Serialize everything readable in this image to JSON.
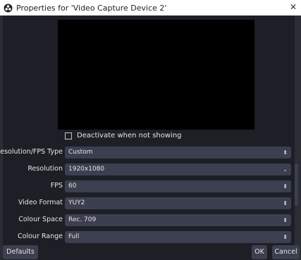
{
  "window": {
    "title": "Properties for 'Video Capture Device 2'",
    "close_glyph": "✕"
  },
  "options": {
    "deactivate_label": "Deactivate when not showing",
    "deactivate_checked": false
  },
  "fields": [
    {
      "label": "Resolution/FPS Type",
      "value": "Custom",
      "control": "spin"
    },
    {
      "label": "Resolution",
      "value": "1920x1080",
      "control": "dropdown"
    },
    {
      "label": "FPS",
      "value": "60",
      "control": "spin"
    },
    {
      "label": "Video Format",
      "value": "YUY2",
      "control": "spin"
    },
    {
      "label": "Colour Space",
      "value": "Rec. 709",
      "control": "spin"
    },
    {
      "label": "Colour Range",
      "value": "Full",
      "control": "spin"
    }
  ],
  "buttons": {
    "defaults": "Defaults",
    "ok": "OK",
    "cancel": "Cancel"
  },
  "colors": {
    "background": "#1e1f26",
    "field": "#3b3f4f",
    "preview": "#000000"
  },
  "icons": {
    "spin": "⬍",
    "dropdown": "⌄"
  }
}
